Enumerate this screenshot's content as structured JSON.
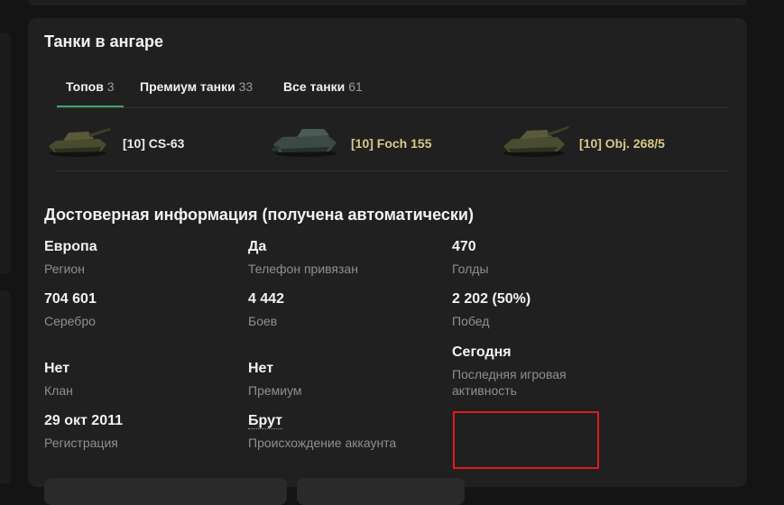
{
  "hangar": {
    "title": "Танки в ангаре",
    "tabs": [
      {
        "label": "Топов",
        "count": "3"
      },
      {
        "label": "Премиум танки",
        "count": "33"
      },
      {
        "label": "Все танки",
        "count": "61"
      }
    ],
    "tanks": [
      {
        "name": "[10] CS-63",
        "premium": false
      },
      {
        "name": "[10] Foch 155",
        "premium": true
      },
      {
        "name": "[10] Obj. 268/5",
        "premium": true
      }
    ]
  },
  "info": {
    "title": "Достоверная информация (получена автоматически)",
    "items": [
      {
        "value": "Европа",
        "label": "Регион"
      },
      {
        "value": "Да",
        "label": "Телефон привязан"
      },
      {
        "value": "470",
        "label": "Голды"
      },
      {
        "value": "704 601",
        "label": "Серебро"
      },
      {
        "value": "4 442",
        "label": "Боев"
      },
      {
        "value": "2 202 (50%)",
        "label": "Побед"
      },
      {
        "value": "Сегодня",
        "label": "Последняя игровая активность"
      },
      {
        "value": "Нет",
        "label": "Клан"
      },
      {
        "value": "Нет",
        "label": "Премиум"
      },
      {
        "value": "29 окт 2011",
        "label": "Регистрация"
      },
      {
        "value": "Брут",
        "label": "Происхождение аккаунта"
      }
    ]
  },
  "colors": {
    "accent": "#3ea66b",
    "premium": "#d7c98a",
    "highlight": "#e01b1b"
  }
}
